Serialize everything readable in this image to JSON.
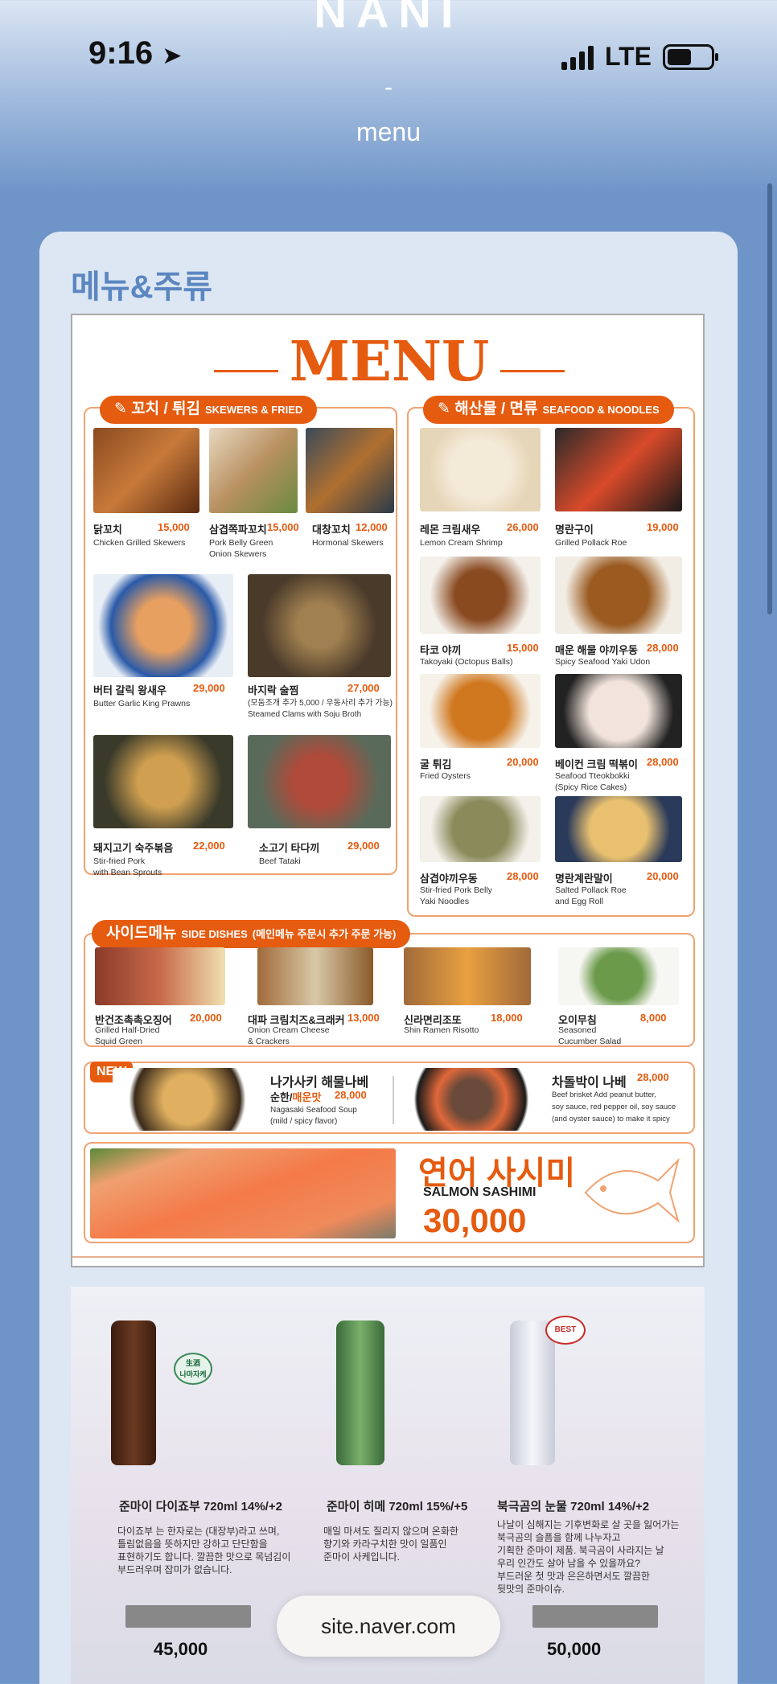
{
  "app": {
    "brand": "NANI"
  },
  "status": {
    "time": "9:16",
    "network": "LTE"
  },
  "nav": {
    "dash": "-",
    "title": "menu"
  },
  "card": {
    "title": "메뉴&주류"
  },
  "menu": {
    "title": "MENU",
    "skewers": {
      "label_ko": "꼬치 / 튀김",
      "label_en": "SKEWERS & FRIED",
      "items": [
        {
          "ko": "닭꼬치",
          "price": "15,000",
          "en": "Chicken Grilled Skewers"
        },
        {
          "ko": "삼겹쪽파꼬치",
          "price": "15,000",
          "en": "Pork Belly Green\nOnion Skewers"
        },
        {
          "ko": "대창꼬치",
          "price": "12,000",
          "en": "Hormonal Skewers"
        },
        {
          "ko": "버터 갈릭 왕새우",
          "price": "29,000",
          "en": "Butter Garlic King Prawns"
        },
        {
          "ko": "바지락 술찜",
          "price": "27,000",
          "en": "(모둠조개 추가 5,000 / 우동사리 추가 가능)\nSteamed Clams with Soju Broth"
        },
        {
          "ko": "돼지고기 숙주볶음",
          "price": "22,000",
          "en": "Stir-fried Pork\nwith Bean Sprouts"
        },
        {
          "ko": "소고기 타다끼",
          "price": "29,000",
          "en": "Beef Tataki"
        }
      ]
    },
    "seafood": {
      "label_ko": "해산물 / 면류",
      "label_en": "SEAFOOD & NOODLES",
      "items": [
        {
          "ko": "레몬 크림새우",
          "price": "26,000",
          "en": "Lemon Cream Shrimp"
        },
        {
          "ko": "명란구이",
          "price": "19,000",
          "en": "Grilled Pollack Roe"
        },
        {
          "ko": "타코 야끼",
          "price": "15,000",
          "en": "Takoyaki (Octopus Balls)"
        },
        {
          "ko": "매운 해물 야끼우동",
          "price": "28,000",
          "en": "Spicy Seafood Yaki Udon"
        },
        {
          "ko": "굴 튀김",
          "price": "20,000",
          "en": "Fried Oysters"
        },
        {
          "ko": "베이컨 크림 떡볶이",
          "price": "28,000",
          "en": "Seafood Tteokbokki\n(Spicy Rice Cakes)"
        },
        {
          "ko": "삼겹야끼우동",
          "price": "28,000",
          "en": "Stir-fried Pork Belly\nYaki Noodles"
        },
        {
          "ko": "명란계란말이",
          "price": "20,000",
          "en": "Salted Pollack Roe\nand Egg Roll"
        }
      ]
    },
    "side": {
      "label_ko": "사이드메뉴",
      "label_en": "SIDE DISHES",
      "note": "(메인메뉴 주문시 추가 주문 가능)",
      "items": [
        {
          "ko": "반건조촉촉오징어",
          "price": "20,000",
          "en": "Grilled Half-Dried\nSquid Green"
        },
        {
          "ko": "대파 크림치즈&크래커",
          "price": "13,000",
          "en": "Onion Cream Cheese\n& Crackers"
        },
        {
          "ko": "신라면리조또",
          "price": "18,000",
          "en": "Shin Ramen Risotto"
        },
        {
          "ko": "오이무침",
          "price": "8,000",
          "en": "Seasoned\nCucumber Salad"
        }
      ]
    },
    "special": {
      "badge": "NEW",
      "nagasaki_ko": "나가사키 해물나베",
      "nagasaki_mild": "순한/",
      "nagasaki_spicy": "매운맛",
      "nagasaki_price": "28,000",
      "nagasaki_en": "Nagasaki Seafood Soup\n(mild / spicy flavor)",
      "brisket_ko": "차돌박이 나베",
      "brisket_price": "28,000",
      "brisket_en": "Beef brisket Add peanut butter,\nsoy sauce, red pepper oil, soy sauce\n(and oyster sauce) to make it spicy"
    },
    "salmon": {
      "ko": "연어 사시미",
      "en": "SALMON SASHIMI",
      "price": "30,000"
    }
  },
  "drinks": [
    {
      "name": "준마이 다이죠부 720ml 14%/+2",
      "desc": "다이죠부 는 한자로는 (대장부)라고 쓰며,\n틀림없음을 뜻하지만 강하고 단단함을\n표현하기도 합니다. 깔끔한 맛으로 목넘김이\n부드러우며 잡미가 없습니다.",
      "price": "45,000",
      "badge": "生酒\n나마자케"
    },
    {
      "name": "준마이 히메 720ml 15%/+5",
      "desc": "매일 마셔도 질리지 않으며 온화한\n향기와 카라구치한 맛이 일품인\n준마이 사케입니다.",
      "price": "",
      "badge": ""
    },
    {
      "name": "북극곰의 눈물 720ml 14%/+2",
      "desc": "나날이 심해지는 기후변화로 살 곳을 잃어가는\n북극곰의 슬픔을 함께 나누자고\n기획한 준마이 제품. 북극곰이 사라지는 날\n우리 인간도 살아 남을 수 있을까요?\n부드러운 첫 맛과 은은하면서도 깔끔한\n뒷맛의 준마이슈.",
      "price": "50,000",
      "badge": "BEST"
    }
  ],
  "url_bar": {
    "host": "site.naver.com"
  }
}
